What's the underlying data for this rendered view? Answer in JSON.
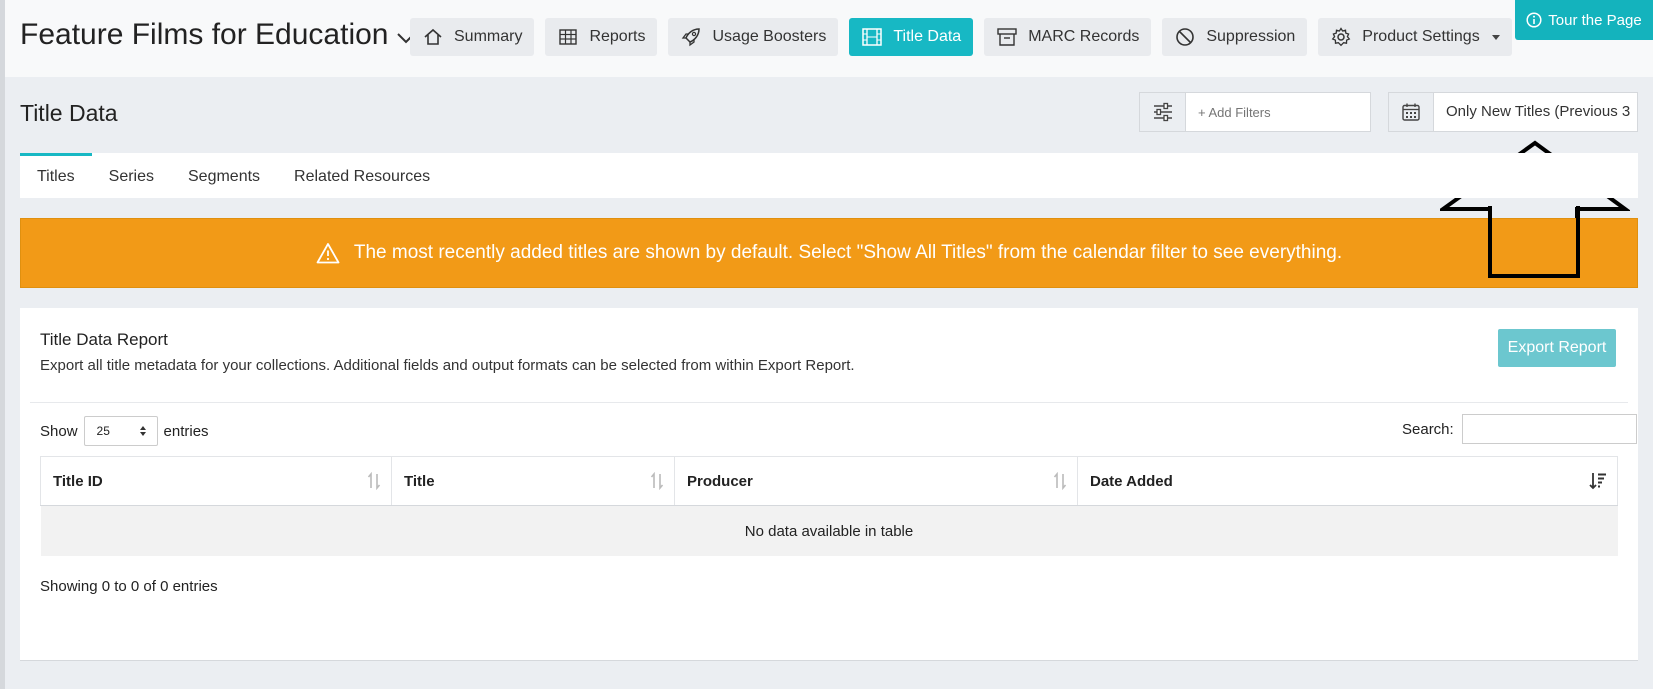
{
  "header": {
    "app_title": "Feature Films for Education",
    "tour_label": "Tour the Page",
    "nav": [
      {
        "label": "Summary",
        "icon": "home-icon",
        "active": false
      },
      {
        "label": "Reports",
        "icon": "table-icon",
        "active": false
      },
      {
        "label": "Usage Boosters",
        "icon": "rocket-icon",
        "active": false
      },
      {
        "label": "Title Data",
        "icon": "film-icon",
        "active": true
      },
      {
        "label": "MARC Records",
        "icon": "archive-icon",
        "active": false
      },
      {
        "label": "Suppression",
        "icon": "ban-icon",
        "active": false
      },
      {
        "label": "Product Settings",
        "icon": "gear-icon",
        "active": false
      }
    ]
  },
  "page": {
    "title": "Title Data",
    "filter_placeholder": "+ Add Filters",
    "date_filter_value": "Only New Titles (Previous 3"
  },
  "tabs": [
    "Titles",
    "Series",
    "Segments",
    "Related Resources"
  ],
  "banner": {
    "text": "The most recently added titles are shown by default. Select \"Show All Titles\" from the calendar filter to see everything.",
    "color": "#f29a17"
  },
  "report": {
    "title": "Title Data Report",
    "description": "Export all title metadata for your collections. Additional fields and output formats can be selected from within Export Report.",
    "export_label": "Export Report",
    "show_label": "Show",
    "entries_value": "25",
    "entries_label": "entries",
    "search_label": "Search:",
    "columns": [
      "Title ID",
      "Title",
      "Producer",
      "Date Added"
    ],
    "empty_message": "No data available in table",
    "info": "Showing 0 to 0 of 0 entries"
  },
  "colors": {
    "accent": "#17b8c4",
    "banner": "#f29a17",
    "export": "#6cc7cf"
  }
}
